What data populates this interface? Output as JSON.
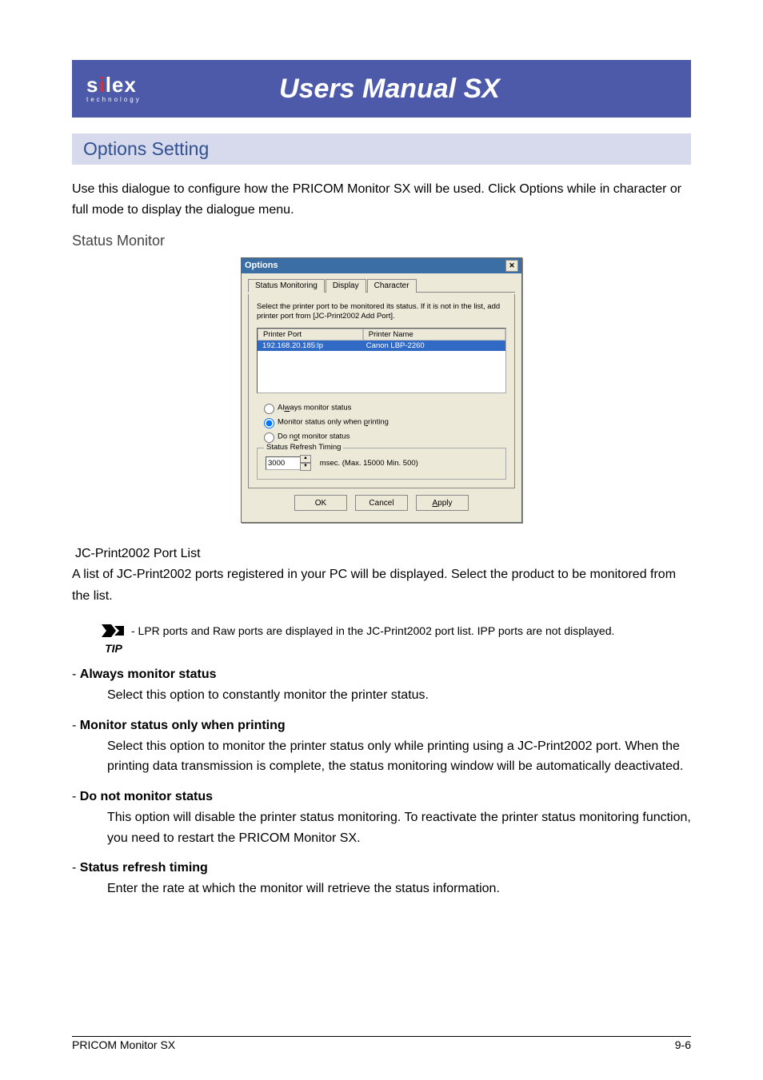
{
  "header": {
    "brand_s": "s",
    "brand_i": "i",
    "brand_rest": "lex",
    "brand_tag": "technology",
    "title": "Users Manual SX"
  },
  "section_heading": "Options Setting",
  "intro_text": "Use this dialogue to configure how the PRICOM Monitor SX will be used. Click Options while in  character or full mode to display the dialogue menu.",
  "sub_heading": "Status Monitor",
  "dialog": {
    "title": "Options",
    "tabs": {
      "t1": "Status Monitoring",
      "t2": "Display",
      "t3": "Character"
    },
    "instruction": "Select the printer port to be monitored its status. If it is not in the list, add printer port from [JC-Print2002 Add Port].",
    "col_port": "Printer Port",
    "col_name": "Printer Name",
    "row_port": "192.168.20.185:lp",
    "row_name": "Canon LBP-2260",
    "radio1": "Always monitor status",
    "radio2": "Monitor status only when printing",
    "radio3": "Do not monitor status",
    "fieldset_legend": "Status Refresh Timing",
    "spin_value": "3000",
    "msec_label": "msec. (Max. 15000  Min. 500)",
    "ok": "OK",
    "cancel": "Cancel",
    "apply": "Apply"
  },
  "portlist_heading": " JC-Print2002 Port List",
  "portlist_text": "A list of JC-Print2002 ports registered in your PC will be displayed. Select the product to be monitored from the list.",
  "tip_label": "TIP",
  "tip_text": "- LPR ports and Raw ports are displayed in the JC-Print2002 port list. IPP ports are not displayed.",
  "options": {
    "o1_title": "Always monitor status",
    "o1_desc": "Select this option to constantly monitor the printer status.",
    "o2_title": "Monitor status only when printing",
    "o2_desc": "Select this option to monitor the printer status only while printing using a JC-Print2002 port.  When the printing data transmission is complete, the status monitoring window will be automatically deactivated.",
    "o3_title": "Do not monitor status",
    "o3_desc": "This option will disable the printer status monitoring.  To reactivate the printer status monitoring function, you need to restart the PRICOM Monitor SX.",
    "o4_title": "Status refresh timing",
    "o4_desc": "Enter the rate at which the monitor will retrieve the status information."
  },
  "footer": {
    "left": "PRICOM Monitor SX",
    "right": "9-6"
  }
}
